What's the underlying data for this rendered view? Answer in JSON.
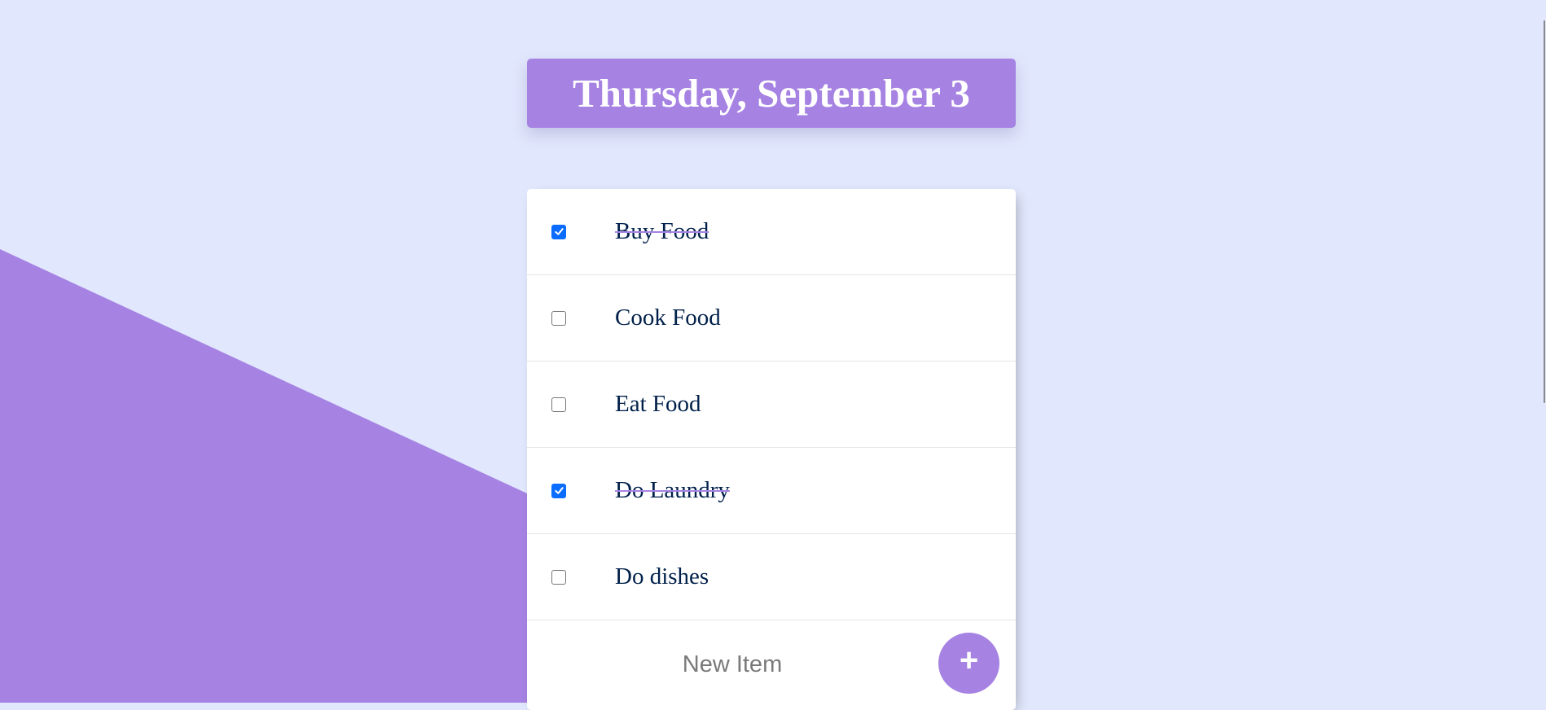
{
  "theme": {
    "background_color": "#E1E7FC",
    "accent_color": "#A683E3",
    "check_color": "#0B6DFF",
    "text_color": "#00204A"
  },
  "header": {
    "title": "Thursday, September 3"
  },
  "todo": {
    "items": [
      {
        "label": "Buy Food",
        "checked": true
      },
      {
        "label": "Cook Food",
        "checked": false
      },
      {
        "label": "Eat Food",
        "checked": false
      },
      {
        "label": "Do Laundry",
        "checked": true
      },
      {
        "label": "Do dishes",
        "checked": false
      }
    ],
    "new_item": {
      "placeholder": "New Item",
      "value": ""
    },
    "add_button": {
      "label": "+"
    }
  },
  "icons": {
    "checkbox_checked": "check-icon"
  }
}
